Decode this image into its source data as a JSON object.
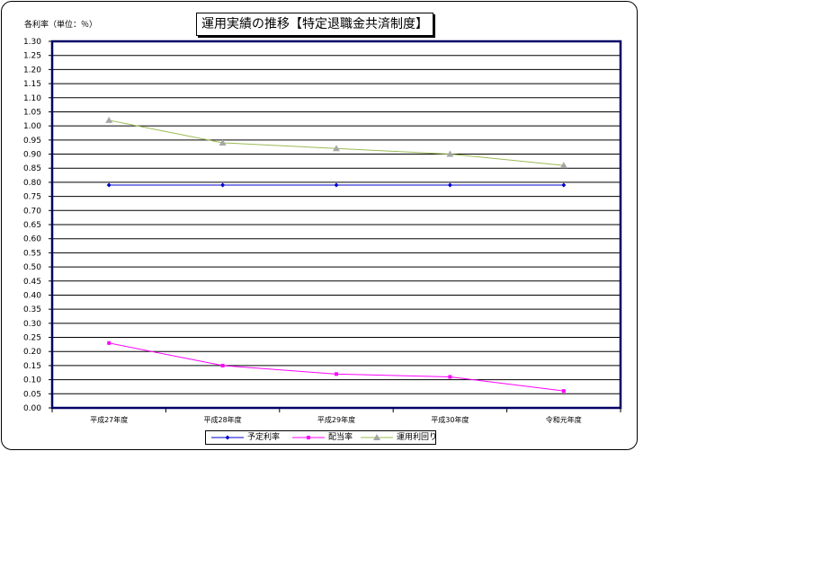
{
  "chart_data": {
    "type": "line",
    "title": "運用実績の推移【特定退職金共済制度】",
    "ylabel": "各利率（単位：％）",
    "categories": [
      "平成27年度",
      "平成28年度",
      "平成29年度",
      "平成30年度",
      "令和元年度"
    ],
    "ylim": [
      0,
      1.3
    ],
    "ytick_step": 0.05,
    "grid": true,
    "legend_position": "bottom",
    "series": [
      {
        "name": "予定利率",
        "values": [
          0.79,
          0.79,
          0.79,
          0.79,
          0.79
        ],
        "color": "#0000cc",
        "marker": "diamond"
      },
      {
        "name": "配当率",
        "values": [
          0.23,
          0.15,
          0.12,
          0.11,
          0.06
        ],
        "color": "#ff00ff",
        "marker": "square"
      },
      {
        "name": "運用利回り",
        "values": [
          1.02,
          0.94,
          0.92,
          0.9,
          0.86
        ],
        "color": "#99bb55",
        "marker": "triangle",
        "marker_color": "#a6a6a6"
      }
    ]
  }
}
